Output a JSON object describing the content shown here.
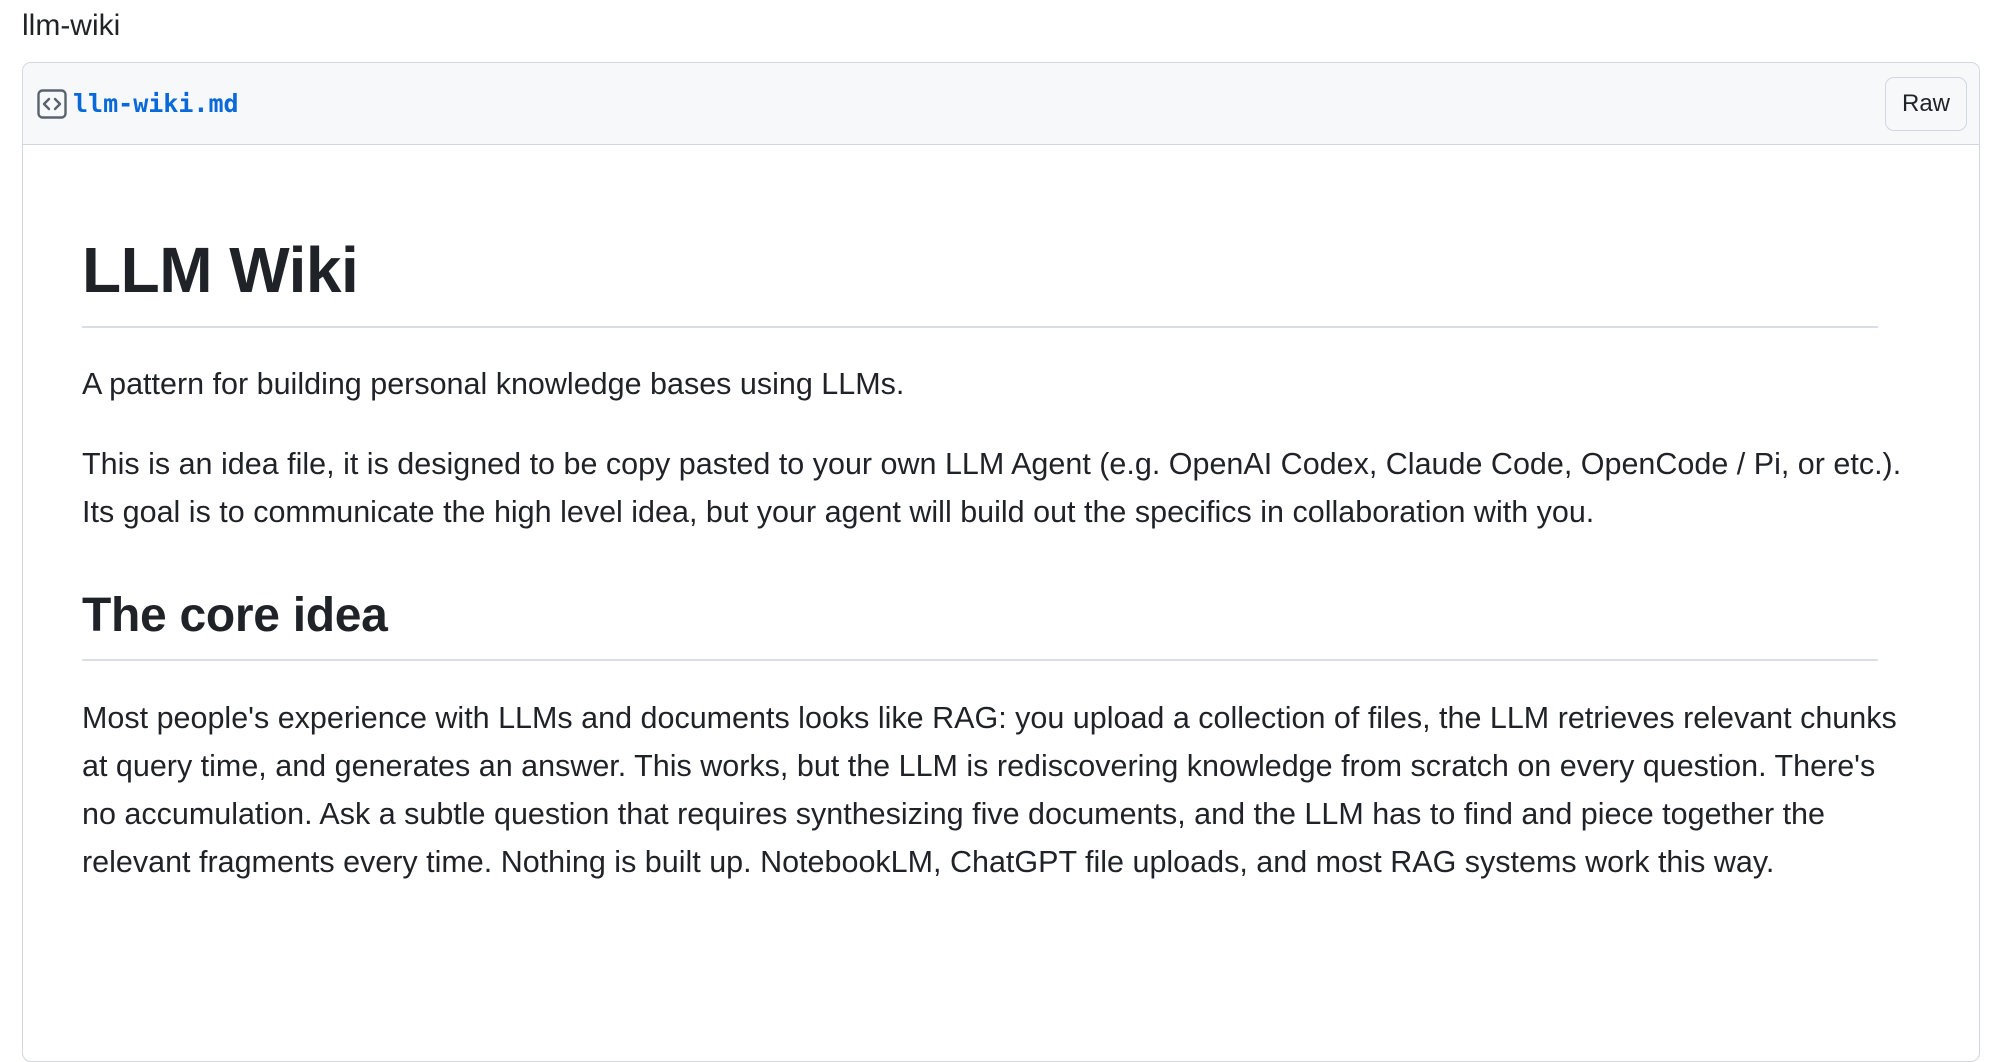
{
  "gist": {
    "name": "llm-wiki"
  },
  "file": {
    "icon": "code-square-icon",
    "filename": "llm-wiki.md",
    "raw_label": "Raw"
  },
  "content": {
    "title": "LLM Wiki",
    "intro": "A pattern for building personal knowledge bases using LLMs.",
    "note": "This is an idea file, it is designed to be copy pasted to your own LLM Agent (e.g. OpenAI Codex, Claude Code, OpenCode / Pi, or etc.). Its goal is to communicate the high level idea, but your agent will build out the specifics in collaboration with you.",
    "section_title": "The core idea",
    "section_body": "Most people's experience with LLMs and documents looks like RAG: you upload a collection of files, the LLM retrieves relevant chunks at query time, and generates an answer. This works, but the LLM is rediscovering knowledge from scratch on every question. There's no accumulation. Ask a subtle question that requires synthesizing five documents, and the LLM has to find and piece together the relevant fragments every time. Nothing is built up. NotebookLM, ChatGPT file uploads, and most RAG systems work this way."
  },
  "colors": {
    "link": "#0969da",
    "border": "#d0d7de",
    "header_bg": "#f6f8fa",
    "text": "#1f2328"
  }
}
